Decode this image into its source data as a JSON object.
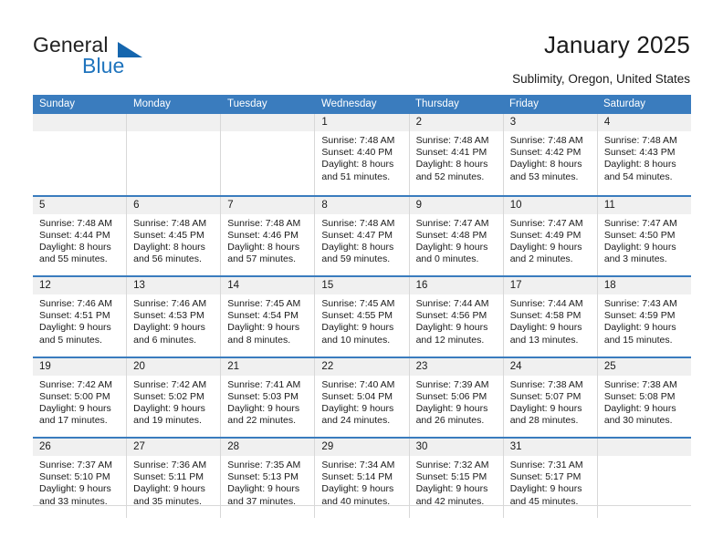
{
  "brand": {
    "name_part1": "General",
    "name_part2": "Blue",
    "triangle_color": "#1566ae",
    "blue_color": "#1f74bd"
  },
  "header": {
    "title": "January 2025",
    "subtitle": "Sublimity, Oregon, United States",
    "header_row_color": "#3a7cbe",
    "date_strip_color": "#f0f0f0"
  },
  "weekdays": [
    "Sunday",
    "Monday",
    "Tuesday",
    "Wednesday",
    "Thursday",
    "Friday",
    "Saturday"
  ],
  "weeks": [
    [
      {
        "date": "",
        "empty": true,
        "sunrise": "",
        "sunset": "",
        "daylight_line1": "",
        "daylight_line2": ""
      },
      {
        "date": "",
        "empty": true,
        "sunrise": "",
        "sunset": "",
        "daylight_line1": "",
        "daylight_line2": ""
      },
      {
        "date": "",
        "empty": true,
        "sunrise": "",
        "sunset": "",
        "daylight_line1": "",
        "daylight_line2": ""
      },
      {
        "date": "1",
        "empty": false,
        "sunrise": "Sunrise: 7:48 AM",
        "sunset": "Sunset: 4:40 PM",
        "daylight_line1": "Daylight: 8 hours",
        "daylight_line2": "and 51 minutes."
      },
      {
        "date": "2",
        "empty": false,
        "sunrise": "Sunrise: 7:48 AM",
        "sunset": "Sunset: 4:41 PM",
        "daylight_line1": "Daylight: 8 hours",
        "daylight_line2": "and 52 minutes."
      },
      {
        "date": "3",
        "empty": false,
        "sunrise": "Sunrise: 7:48 AM",
        "sunset": "Sunset: 4:42 PM",
        "daylight_line1": "Daylight: 8 hours",
        "daylight_line2": "and 53 minutes."
      },
      {
        "date": "4",
        "empty": false,
        "sunrise": "Sunrise: 7:48 AM",
        "sunset": "Sunset: 4:43 PM",
        "daylight_line1": "Daylight: 8 hours",
        "daylight_line2": "and 54 minutes."
      }
    ],
    [
      {
        "date": "5",
        "empty": false,
        "sunrise": "Sunrise: 7:48 AM",
        "sunset": "Sunset: 4:44 PM",
        "daylight_line1": "Daylight: 8 hours",
        "daylight_line2": "and 55 minutes."
      },
      {
        "date": "6",
        "empty": false,
        "sunrise": "Sunrise: 7:48 AM",
        "sunset": "Sunset: 4:45 PM",
        "daylight_line1": "Daylight: 8 hours",
        "daylight_line2": "and 56 minutes."
      },
      {
        "date": "7",
        "empty": false,
        "sunrise": "Sunrise: 7:48 AM",
        "sunset": "Sunset: 4:46 PM",
        "daylight_line1": "Daylight: 8 hours",
        "daylight_line2": "and 57 minutes."
      },
      {
        "date": "8",
        "empty": false,
        "sunrise": "Sunrise: 7:48 AM",
        "sunset": "Sunset: 4:47 PM",
        "daylight_line1": "Daylight: 8 hours",
        "daylight_line2": "and 59 minutes."
      },
      {
        "date": "9",
        "empty": false,
        "sunrise": "Sunrise: 7:47 AM",
        "sunset": "Sunset: 4:48 PM",
        "daylight_line1": "Daylight: 9 hours",
        "daylight_line2": "and 0 minutes."
      },
      {
        "date": "10",
        "empty": false,
        "sunrise": "Sunrise: 7:47 AM",
        "sunset": "Sunset: 4:49 PM",
        "daylight_line1": "Daylight: 9 hours",
        "daylight_line2": "and 2 minutes."
      },
      {
        "date": "11",
        "empty": false,
        "sunrise": "Sunrise: 7:47 AM",
        "sunset": "Sunset: 4:50 PM",
        "daylight_line1": "Daylight: 9 hours",
        "daylight_line2": "and 3 minutes."
      }
    ],
    [
      {
        "date": "12",
        "empty": false,
        "sunrise": "Sunrise: 7:46 AM",
        "sunset": "Sunset: 4:51 PM",
        "daylight_line1": "Daylight: 9 hours",
        "daylight_line2": "and 5 minutes."
      },
      {
        "date": "13",
        "empty": false,
        "sunrise": "Sunrise: 7:46 AM",
        "sunset": "Sunset: 4:53 PM",
        "daylight_line1": "Daylight: 9 hours",
        "daylight_line2": "and 6 minutes."
      },
      {
        "date": "14",
        "empty": false,
        "sunrise": "Sunrise: 7:45 AM",
        "sunset": "Sunset: 4:54 PM",
        "daylight_line1": "Daylight: 9 hours",
        "daylight_line2": "and 8 minutes."
      },
      {
        "date": "15",
        "empty": false,
        "sunrise": "Sunrise: 7:45 AM",
        "sunset": "Sunset: 4:55 PM",
        "daylight_line1": "Daylight: 9 hours",
        "daylight_line2": "and 10 minutes."
      },
      {
        "date": "16",
        "empty": false,
        "sunrise": "Sunrise: 7:44 AM",
        "sunset": "Sunset: 4:56 PM",
        "daylight_line1": "Daylight: 9 hours",
        "daylight_line2": "and 12 minutes."
      },
      {
        "date": "17",
        "empty": false,
        "sunrise": "Sunrise: 7:44 AM",
        "sunset": "Sunset: 4:58 PM",
        "daylight_line1": "Daylight: 9 hours",
        "daylight_line2": "and 13 minutes."
      },
      {
        "date": "18",
        "empty": false,
        "sunrise": "Sunrise: 7:43 AM",
        "sunset": "Sunset: 4:59 PM",
        "daylight_line1": "Daylight: 9 hours",
        "daylight_line2": "and 15 minutes."
      }
    ],
    [
      {
        "date": "19",
        "empty": false,
        "sunrise": "Sunrise: 7:42 AM",
        "sunset": "Sunset: 5:00 PM",
        "daylight_line1": "Daylight: 9 hours",
        "daylight_line2": "and 17 minutes."
      },
      {
        "date": "20",
        "empty": false,
        "sunrise": "Sunrise: 7:42 AM",
        "sunset": "Sunset: 5:02 PM",
        "daylight_line1": "Daylight: 9 hours",
        "daylight_line2": "and 19 minutes."
      },
      {
        "date": "21",
        "empty": false,
        "sunrise": "Sunrise: 7:41 AM",
        "sunset": "Sunset: 5:03 PM",
        "daylight_line1": "Daylight: 9 hours",
        "daylight_line2": "and 22 minutes."
      },
      {
        "date": "22",
        "empty": false,
        "sunrise": "Sunrise: 7:40 AM",
        "sunset": "Sunset: 5:04 PM",
        "daylight_line1": "Daylight: 9 hours",
        "daylight_line2": "and 24 minutes."
      },
      {
        "date": "23",
        "empty": false,
        "sunrise": "Sunrise: 7:39 AM",
        "sunset": "Sunset: 5:06 PM",
        "daylight_line1": "Daylight: 9 hours",
        "daylight_line2": "and 26 minutes."
      },
      {
        "date": "24",
        "empty": false,
        "sunrise": "Sunrise: 7:38 AM",
        "sunset": "Sunset: 5:07 PM",
        "daylight_line1": "Daylight: 9 hours",
        "daylight_line2": "and 28 minutes."
      },
      {
        "date": "25",
        "empty": false,
        "sunrise": "Sunrise: 7:38 AM",
        "sunset": "Sunset: 5:08 PM",
        "daylight_line1": "Daylight: 9 hours",
        "daylight_line2": "and 30 minutes."
      }
    ],
    [
      {
        "date": "26",
        "empty": false,
        "sunrise": "Sunrise: 7:37 AM",
        "sunset": "Sunset: 5:10 PM",
        "daylight_line1": "Daylight: 9 hours",
        "daylight_line2": "and 33 minutes."
      },
      {
        "date": "27",
        "empty": false,
        "sunrise": "Sunrise: 7:36 AM",
        "sunset": "Sunset: 5:11 PM",
        "daylight_line1": "Daylight: 9 hours",
        "daylight_line2": "and 35 minutes."
      },
      {
        "date": "28",
        "empty": false,
        "sunrise": "Sunrise: 7:35 AM",
        "sunset": "Sunset: 5:13 PM",
        "daylight_line1": "Daylight: 9 hours",
        "daylight_line2": "and 37 minutes."
      },
      {
        "date": "29",
        "empty": false,
        "sunrise": "Sunrise: 7:34 AM",
        "sunset": "Sunset: 5:14 PM",
        "daylight_line1": "Daylight: 9 hours",
        "daylight_line2": "and 40 minutes."
      },
      {
        "date": "30",
        "empty": false,
        "sunrise": "Sunrise: 7:32 AM",
        "sunset": "Sunset: 5:15 PM",
        "daylight_line1": "Daylight: 9 hours",
        "daylight_line2": "and 42 minutes."
      },
      {
        "date": "31",
        "empty": false,
        "sunrise": "Sunrise: 7:31 AM",
        "sunset": "Sunset: 5:17 PM",
        "daylight_line1": "Daylight: 9 hours",
        "daylight_line2": "and 45 minutes."
      },
      {
        "date": "",
        "empty": true,
        "sunrise": "",
        "sunset": "",
        "daylight_line1": "",
        "daylight_line2": ""
      }
    ]
  ]
}
